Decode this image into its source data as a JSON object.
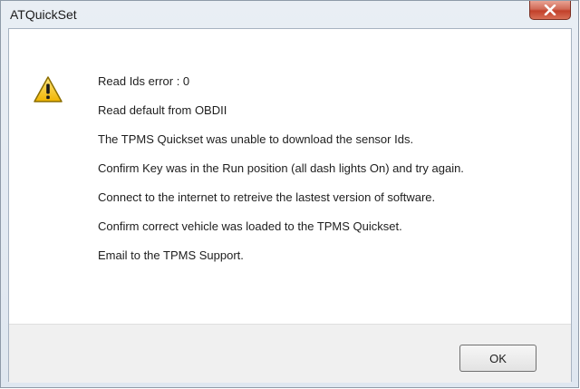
{
  "window": {
    "title": "ATQuickSet"
  },
  "icons": {
    "warning": "warning-icon",
    "close": "close-icon"
  },
  "colors": {
    "warning_fill": "#f5c518",
    "close_button": "#c9503a"
  },
  "messages": [
    "Read Ids error : 0",
    "Read default from OBDII",
    "The TPMS Quickset was unable to download the sensor Ids.",
    "Confirm Key was in the Run position (all dash lights On) and try again.",
    "Connect to the internet to retreive the lastest version of software.",
    "Confirm correct vehicle was loaded to the TPMS Quickset.",
    "Email to the TPMS Support."
  ],
  "buttons": {
    "ok_label": "OK"
  }
}
